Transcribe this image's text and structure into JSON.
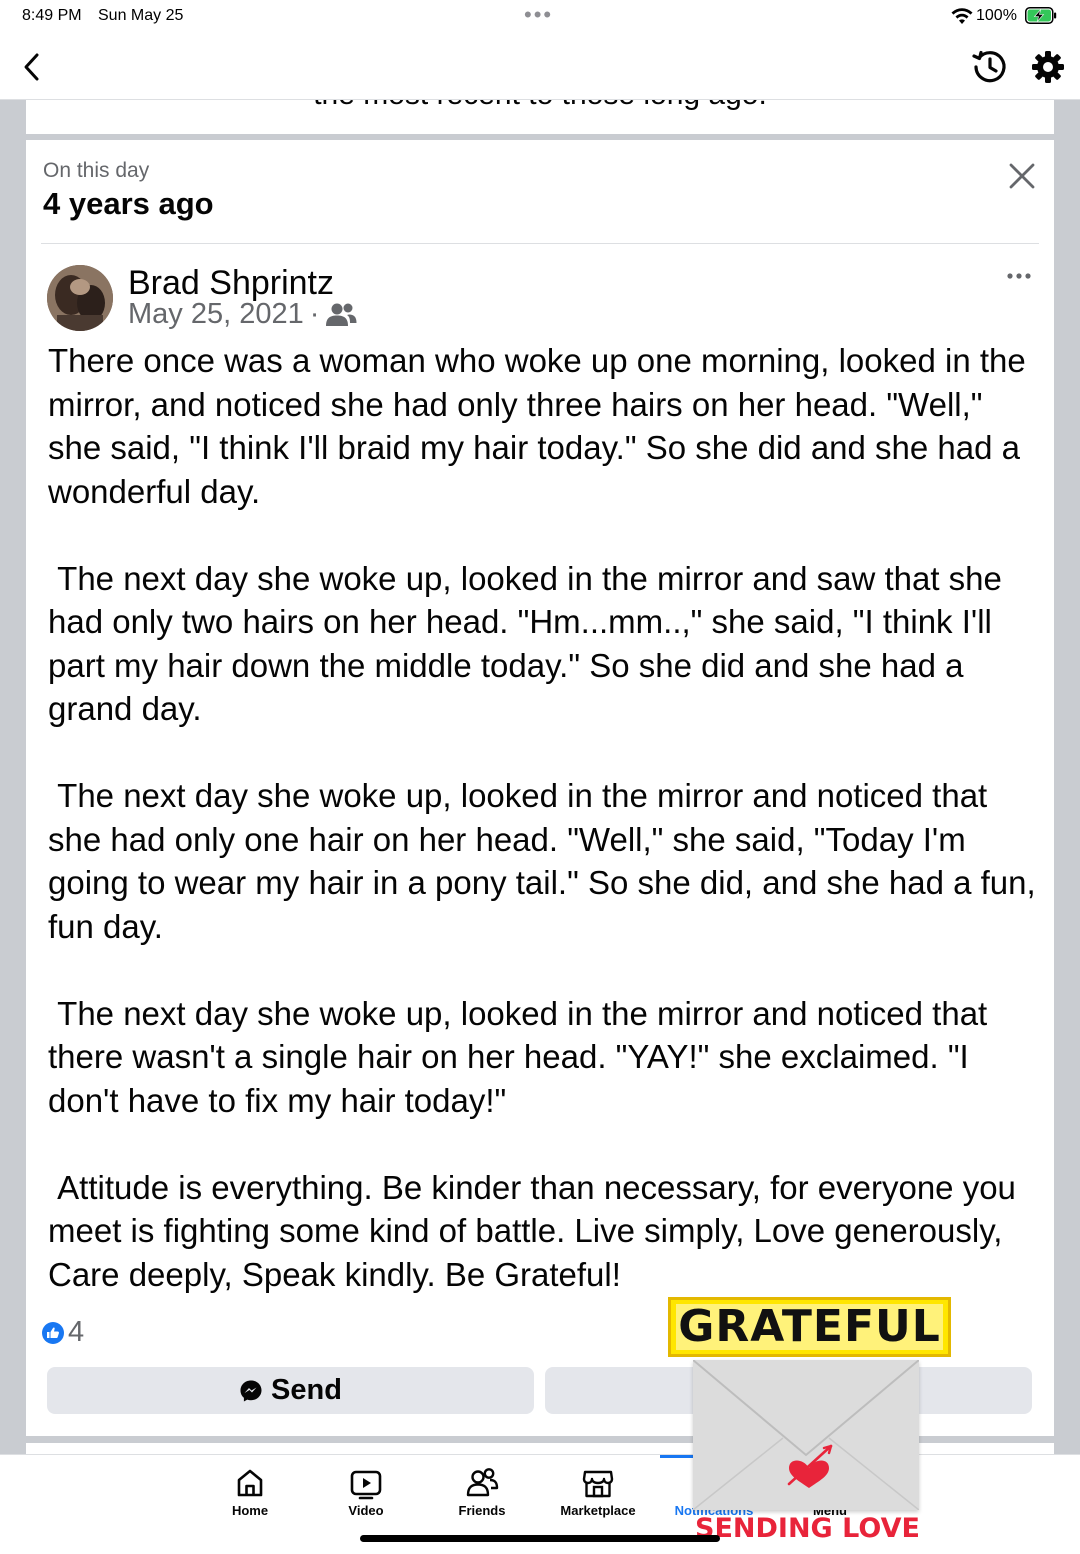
{
  "status_bar": {
    "time": "8:49 PM",
    "date": "Sun May 25",
    "battery": "100%"
  },
  "nav": {
    "back_icon": "chevron-left-icon",
    "history_icon": "history-icon",
    "settings_icon": "gear-icon"
  },
  "previous_card": {
    "cut_text": "the most recent to those long ago."
  },
  "memory": {
    "label": "On this day",
    "years_ago": "4 years ago",
    "post": {
      "author": "Brad Shprintz",
      "date": "May 25, 2021",
      "separator": "·",
      "audience_icon": "friends-icon",
      "paragraphs": [
        "There once was a woman who woke up one morning, looked in the mirror, and noticed she had only three hairs on her head. \"Well,\" she said, \"I think I'll braid my hair today.\" So she did and she had a wonderful day.",
        " The next day she woke up, looked in the mirror and saw that she had only two hairs on her head. \"Hm...mm..,\" she said, \"I think I'll part my hair down the middle today.\" So she did and she had a grand day.",
        " The next day she woke up, looked in the mirror and noticed that she had only one hair on her head. \"Well,\" she said, \"Today I'm going to wear my hair in a pony tail.\" So she did, and she had a fun, fun day.",
        " The next day she woke up, looked in the mirror and noticed that there wasn't a single hair on her head. \"YAY!\" she exclaimed. \"I don't have to fix my hair today!\"",
        " Attitude is everything. Be kinder than necessary, for everyone you meet is fighting some kind of battle. Live simply, Love generously, Care deeply, Speak kindly. Be Grateful!"
      ],
      "reaction_count": "4",
      "send_label": "Send"
    }
  },
  "stickers": {
    "grateful": "GRATEFUL",
    "sending_love": "SENDING LOVE"
  },
  "tabs": [
    {
      "label": "Home",
      "icon": "home-icon"
    },
    {
      "label": "Video",
      "icon": "video-icon"
    },
    {
      "label": "Friends",
      "icon": "friends-icon"
    },
    {
      "label": "Marketplace",
      "icon": "marketplace-icon"
    },
    {
      "label": "Notifications",
      "icon": "bell-icon",
      "active": true
    },
    {
      "label": "Menu",
      "icon": "menu-icon"
    }
  ],
  "colors": {
    "accent": "#1877f2",
    "secondary_text": "#65676b",
    "button_bg": "#e4e6eb",
    "page_bg": "#c9ccd1"
  }
}
